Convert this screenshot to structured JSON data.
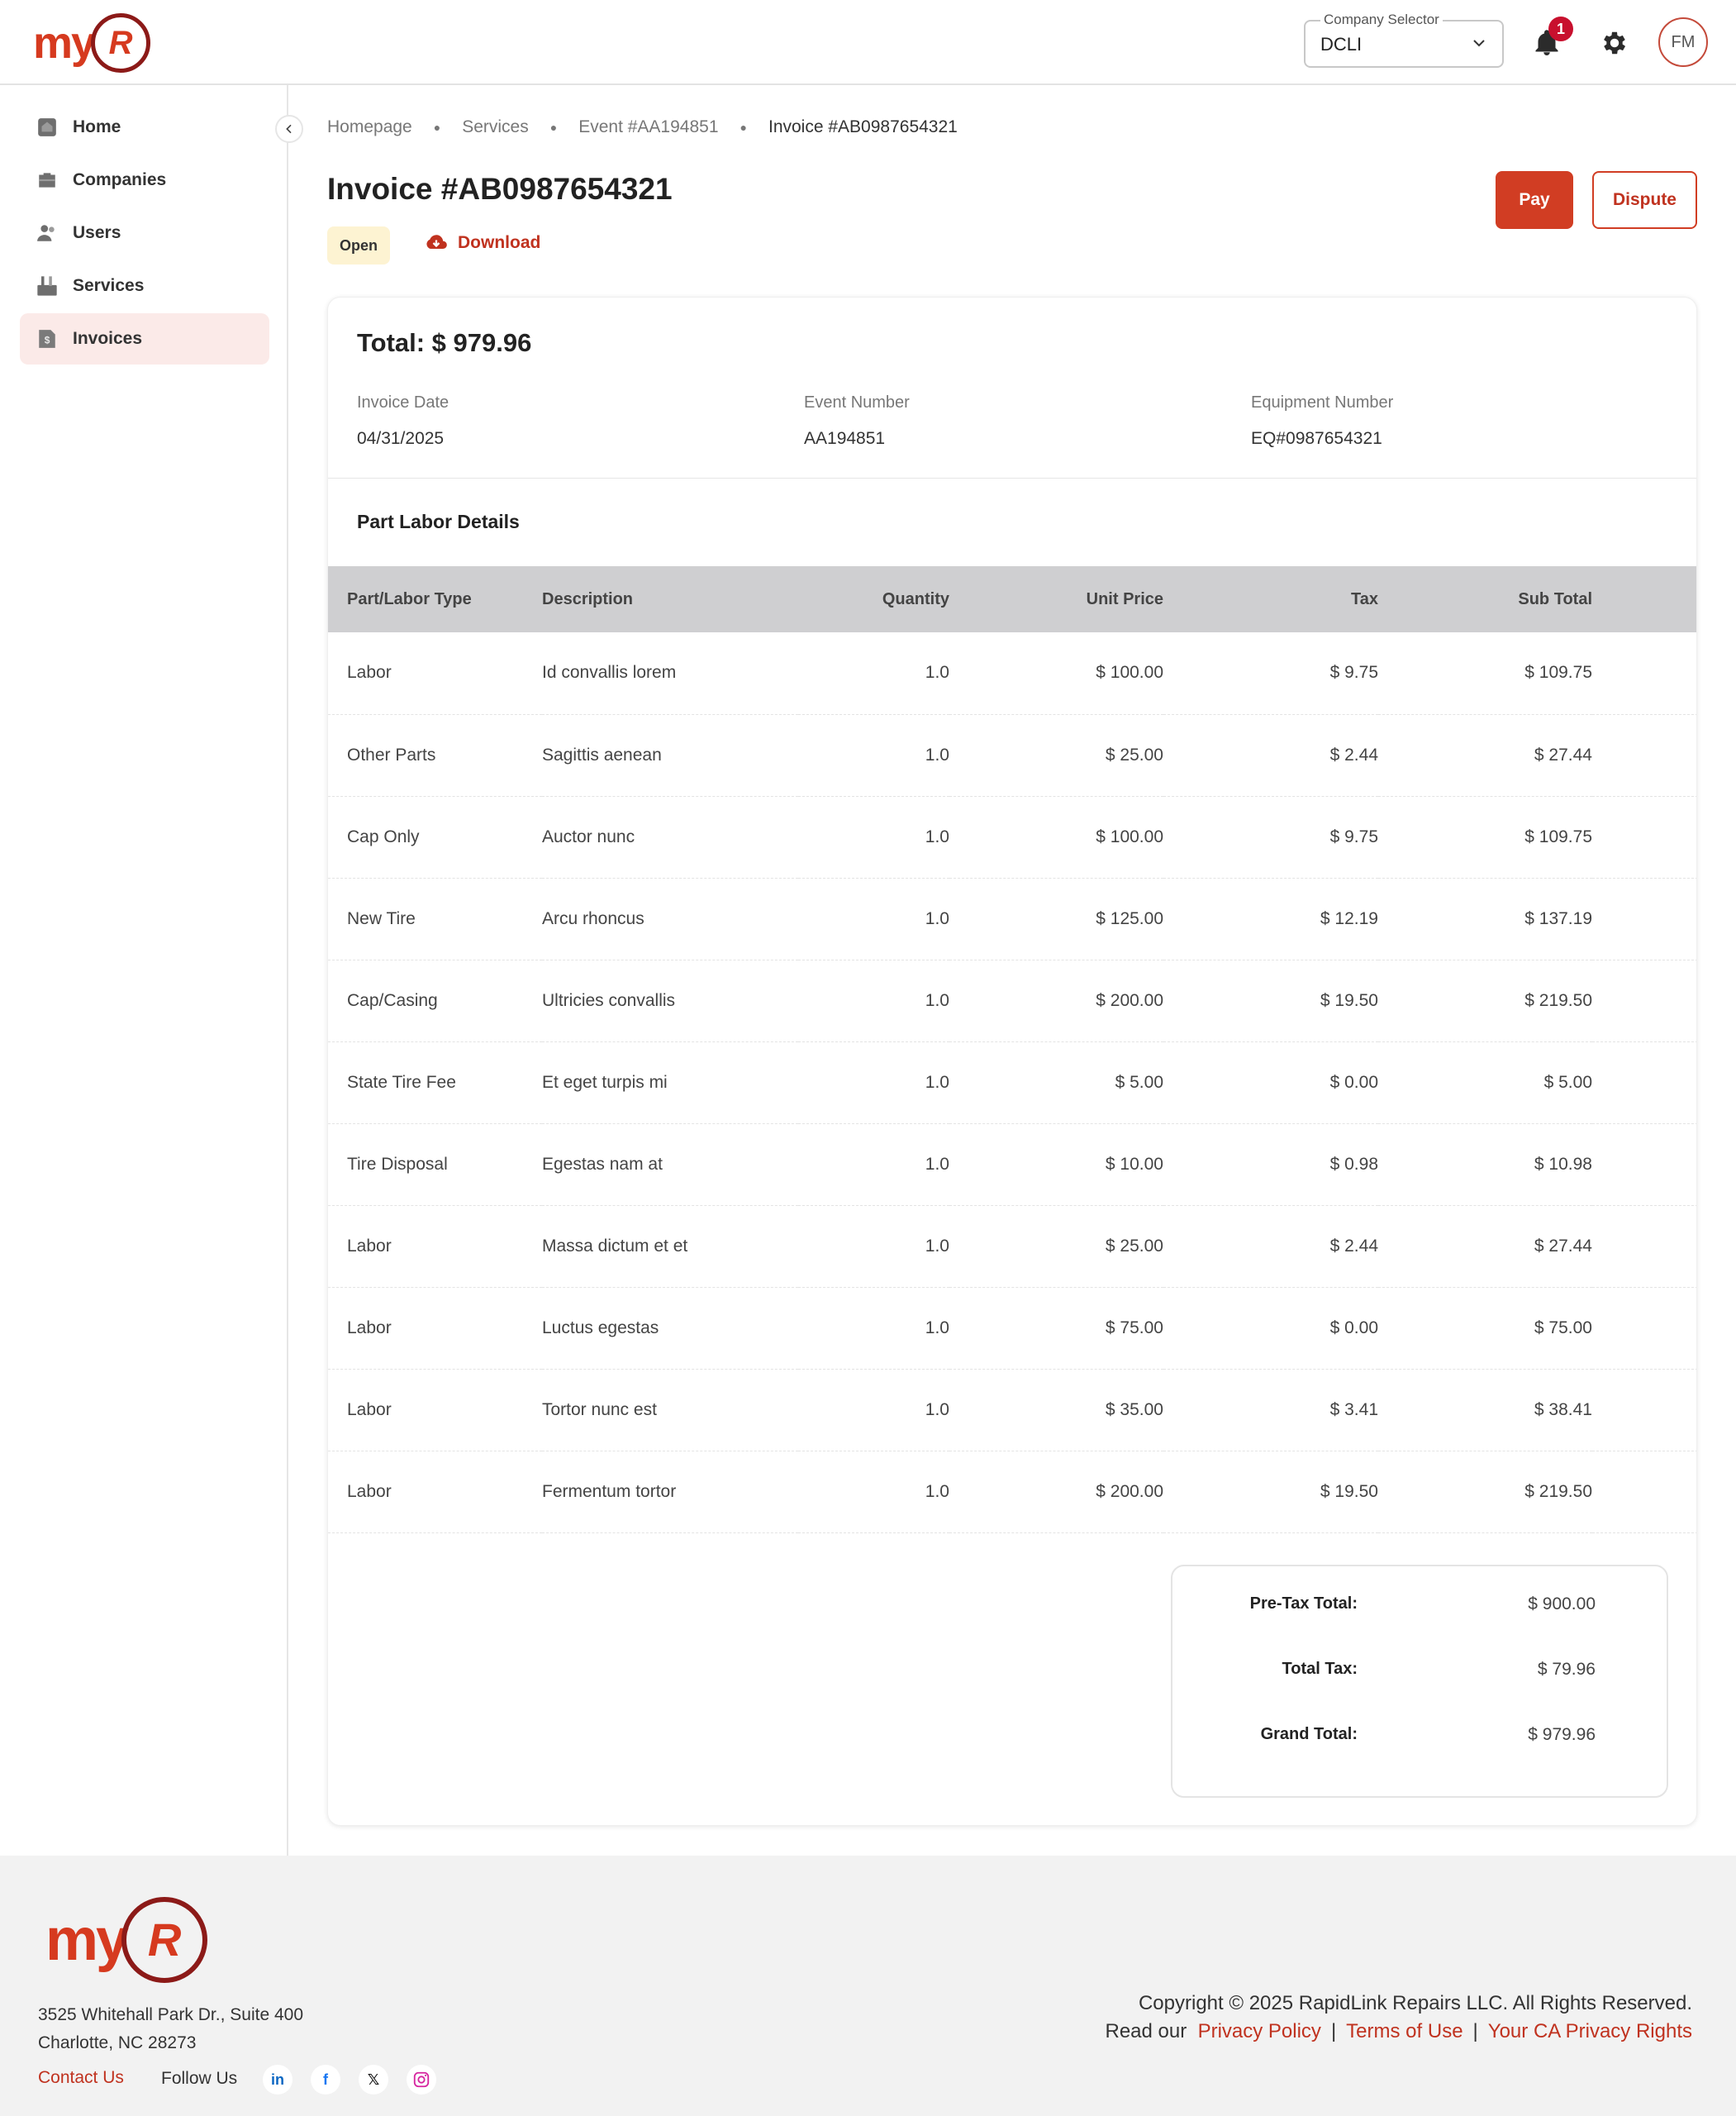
{
  "header": {
    "logo": {
      "text": "my",
      "badge": "R"
    },
    "company_selector": {
      "label": "Company Selector",
      "value": "DCLI"
    },
    "notifications": {
      "count": "1"
    },
    "avatar_initials": "FM",
    "accent_color": "#d13d23"
  },
  "sidebar": {
    "items": [
      {
        "label": "Home",
        "icon": "home-icon",
        "active": false
      },
      {
        "label": "Companies",
        "icon": "briefcase-icon",
        "active": false
      },
      {
        "label": "Users",
        "icon": "users-icon",
        "active": false
      },
      {
        "label": "Services",
        "icon": "tools-icon",
        "active": false
      },
      {
        "label": "Invoices",
        "icon": "invoice-icon",
        "active": true
      }
    ]
  },
  "breadcrumb": [
    "Homepage",
    "Services",
    "Event #AA194851",
    "Invoice #AB0987654321"
  ],
  "page": {
    "title": "Invoice #AB0987654321",
    "status": "Open",
    "download_label": "Download",
    "pay_label": "Pay",
    "dispute_label": "Dispute"
  },
  "summary": {
    "total": "Total: $ 979.96",
    "invoice_date_label": "Invoice Date",
    "invoice_date": "04/31/2025",
    "event_number_label": "Event Number",
    "event_number": "AA194851",
    "equipment_number_label": "Equipment Number",
    "equipment_number": "EQ#0987654321"
  },
  "details": {
    "title": "Part Labor Details",
    "columns": [
      "Part/Labor Type",
      "Description",
      "Quantity",
      "Unit Price",
      "Tax",
      "Sub Total"
    ],
    "rows": [
      [
        "Labor",
        "Id convallis lorem",
        "1.0",
        "$ 100.00",
        "$ 9.75",
        "$ 109.75"
      ],
      [
        "Other Parts",
        "Sagittis aenean",
        "1.0",
        "$ 25.00",
        "$ 2.44",
        "$ 27.44"
      ],
      [
        "Cap Only",
        "Auctor nunc",
        "1.0",
        "$ 100.00",
        "$ 9.75",
        "$ 109.75"
      ],
      [
        "New Tire",
        "Arcu rhoncus",
        "1.0",
        "$ 125.00",
        "$ 12.19",
        "$ 137.19"
      ],
      [
        "Cap/Casing",
        "Ultricies convallis",
        "1.0",
        "$ 200.00",
        "$ 19.50",
        "$ 219.50"
      ],
      [
        "State Tire Fee",
        "Et eget turpis mi",
        "1.0",
        "$ 5.00",
        "$ 0.00",
        "$ 5.00"
      ],
      [
        "Tire Disposal",
        "Egestas nam at",
        "1.0",
        "$ 10.00",
        "$ 0.98",
        "$ 10.98"
      ],
      [
        "Labor",
        "Massa dictum et et",
        "1.0",
        "$ 25.00",
        "$ 2.44",
        "$ 27.44"
      ],
      [
        "Labor",
        "Luctus egestas",
        "1.0",
        "$ 75.00",
        "$ 0.00",
        "$ 75.00"
      ],
      [
        "Labor",
        "Tortor nunc est",
        "1.0",
        "$ 35.00",
        "$ 3.41",
        "$ 38.41"
      ],
      [
        "Labor",
        "Fermentum tortor",
        "1.0",
        "$ 200.00",
        "$ 19.50",
        "$ 219.50"
      ]
    ]
  },
  "totals": {
    "pretax_label": "Pre-Tax Total:",
    "pretax_value": "$ 900.00",
    "tax_label": "Total Tax:",
    "tax_value": "$ 79.96",
    "grand_label": "Grand Total:",
    "grand_value": "$ 979.96"
  },
  "footer": {
    "address_line1": "3525 Whitehall Park Dr., Suite 400",
    "address_line2": "Charlotte, NC 28273",
    "contact_label": "Contact Us",
    "follow_label": "Follow Us",
    "social": [
      "linkedin-icon",
      "facebook-icon",
      "x-icon",
      "instagram-icon"
    ],
    "copyright": "Copyright © 2025 RapidLink Repairs LLC. All Rights Reserved.",
    "read_our": "Read our",
    "privacy_policy": "Privacy Policy",
    "terms_of_use": "Terms of Use",
    "ca_privacy": "Your CA Privacy Rights"
  }
}
